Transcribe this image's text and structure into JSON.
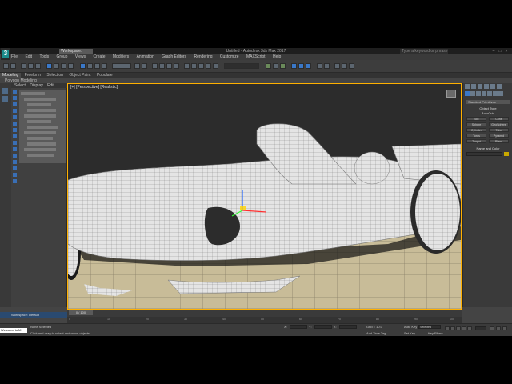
{
  "titlebar": {
    "app_logo": "3",
    "workspace_dropdown": "Workspace: Default",
    "window_title": "Untitled - Autodesk 3ds Max 2017",
    "search_placeholder": "Type a keyword or phrase",
    "window_buttons": [
      "–",
      "□",
      "×"
    ]
  },
  "menubar": {
    "items": [
      "File",
      "Edit",
      "Tools",
      "Group",
      "Views",
      "Create",
      "Modifiers",
      "Animation",
      "Graph Editors",
      "Rendering",
      "Customize",
      "MAXScript",
      "Help"
    ]
  },
  "ribbon": {
    "tabs": [
      "Modeling",
      "Freeform",
      "Selection",
      "Object Paint",
      "Populate"
    ],
    "sub": "Polygon Modeling"
  },
  "scene_explorer": {
    "tabs": [
      "Select",
      "Display",
      "Edit"
    ]
  },
  "viewport": {
    "label": "[+] [Perspective] [Realistic]"
  },
  "command_panel": {
    "dropdown": "Standard Primitives",
    "object_type_header": "Object Type",
    "autogrid": "AutoGrid",
    "buttons": [
      "Box",
      "Cone",
      "Sphere",
      "GeoSphere",
      "Cylinder",
      "Tube",
      "Torus",
      "Pyramid",
      "Teapot",
      "Plane"
    ],
    "name_color_header": "Name and Color",
    "color_accent": "#c8a800"
  },
  "timeline": {
    "slider_label": "0 / 100",
    "ticks": [
      "0",
      "10",
      "20",
      "30",
      "40",
      "50",
      "60",
      "70",
      "80",
      "90",
      "100"
    ]
  },
  "statusbar": {
    "workspace_label": "Workspace: Default",
    "maxscript": "Welcome to M",
    "selection": "None Selected",
    "prompt": "Click and drag to select and move objects",
    "x_label": "X:",
    "y_label": "Y:",
    "z_label": "Z:",
    "grid": "Grid = 10.0",
    "auto_key": "Auto Key",
    "set_key": "Set Key",
    "selected": "Selected",
    "key_filters": "Key Filters...",
    "add_time_tag": "Add Time Tag"
  }
}
